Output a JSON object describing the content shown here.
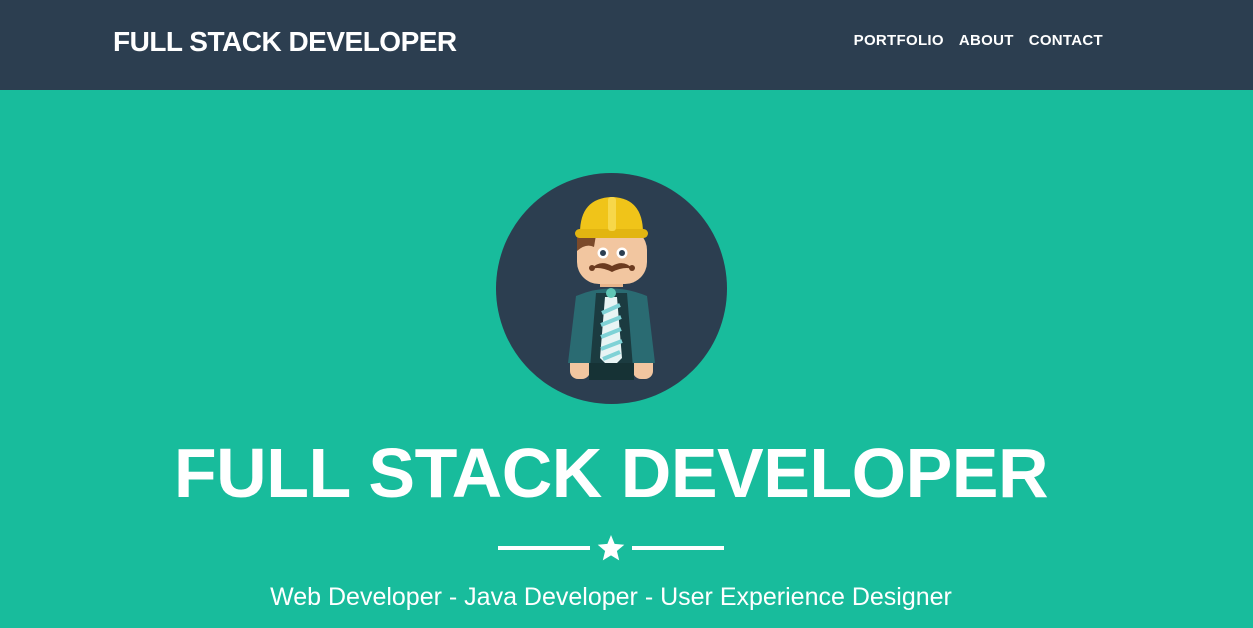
{
  "navbar": {
    "brand": "FULL STACK DEVELOPER",
    "links": [
      "PORTFOLIO",
      "ABOUT",
      "CONTACT"
    ]
  },
  "hero": {
    "title": "FULL STACK DEVELOPER",
    "tagline": "Web Developer - Java Developer - User Experience Designer",
    "divider_icon": "star-icon",
    "avatar_icon": "developer-avatar-icon"
  },
  "colors": {
    "navbar_bg": "#2c3e50",
    "hero_bg": "#18bc9c",
    "text": "#ffffff",
    "helmet": "#f0c419"
  }
}
